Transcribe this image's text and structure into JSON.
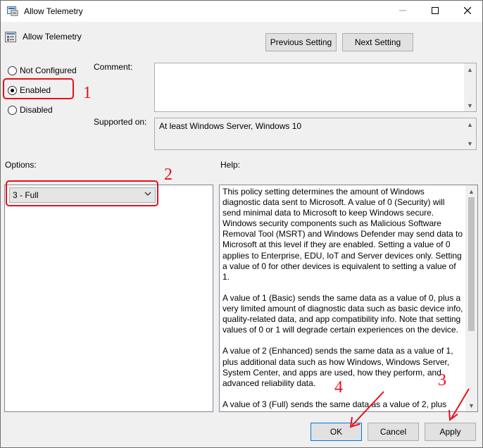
{
  "window": {
    "title": "Allow Telemetry"
  },
  "header": {
    "policy_name": "Allow Telemetry"
  },
  "nav": {
    "previous_label": "Previous Setting",
    "next_label": "Next Setting"
  },
  "state": {
    "options": [
      {
        "label": "Not Configured",
        "checked": false
      },
      {
        "label": "Enabled",
        "checked": true
      },
      {
        "label": "Disabled",
        "checked": false
      }
    ]
  },
  "comment": {
    "label": "Comment:",
    "value": ""
  },
  "supported": {
    "label": "Supported on:",
    "value": "At least Windows Server, Windows 10"
  },
  "options_section": {
    "label": "Options:",
    "selected": "3 - Full"
  },
  "help_section": {
    "label": "Help:",
    "paragraphs": [
      "This policy setting determines the amount of Windows diagnostic data sent to Microsoft. A value of 0 (Security) will send minimal data to Microsoft to keep Windows secure. Windows security components such as Malicious Software Removal Tool (MSRT) and Windows Defender may send data to Microsoft at this level if they are enabled. Setting a value of 0 applies to Enterprise, EDU, IoT and Server devices only. Setting a value of 0 for other devices is equivalent to setting a value of 1.",
      "A value of 1 (Basic) sends the same data as a value of 0, plus a very limited amount of diagnostic data such as basic device info, quality-related data, and app compatibility info. Note that setting values of 0 or 1 will degrade certain experiences on the device.",
      "A value of 2 (Enhanced) sends the same data as a value of 1, plus additional data such as how Windows, Windows Server, System Center, and apps are used, how they perform, and advanced reliability data.",
      "A value of 3 (Full) sends the same data as a value of 2, plus"
    ]
  },
  "footer": {
    "ok_label": "OK",
    "cancel_label": "Cancel",
    "apply_label": "Apply"
  },
  "annotations": {
    "n1": "1",
    "n2": "2",
    "n3": "3",
    "n4": "4",
    "color": "#e8101a"
  }
}
